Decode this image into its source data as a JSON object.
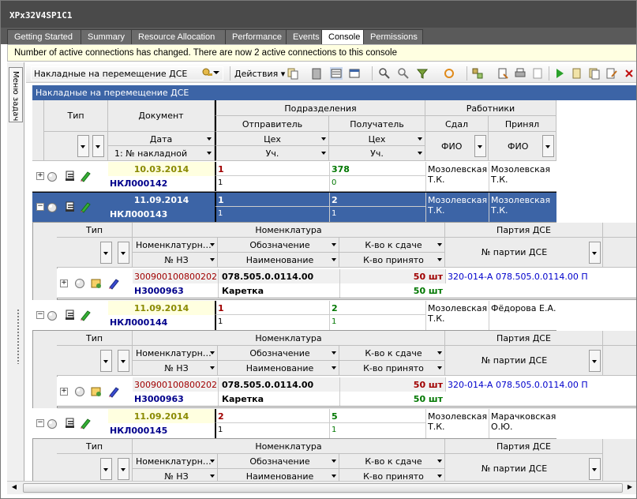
{
  "window": {
    "title": "XPx32V4SP1C1"
  },
  "tabs": [
    "Getting Started",
    "Summary",
    "Resource Allocation",
    "Performance",
    "Events",
    "Console",
    "Permissions"
  ],
  "notice": "Number of active connections has changed. There are now 2 active connections to this console",
  "leftpane": {
    "label": "Меню задач"
  },
  "toolbar": {
    "combo_value": "Накладные на перемещение ДСЕ",
    "actions_label": "Действия"
  },
  "grid": {
    "title": "Накладные на перемещение ДСЕ",
    "header": {
      "type": "Тип",
      "document": "Документ",
      "divisions": "Подразделения",
      "workers": "Работники",
      "sender": "Отправитель",
      "receiver": "Получатель",
      "gave": "Сдал",
      "took": "Принял",
      "date": "Дата",
      "doc_no": "1: № накладной",
      "shop1": "Цех",
      "shop2": "Цех",
      "sec1": "Уч.",
      "sec2": "Уч.",
      "fio1": "ФИО",
      "fio2": "ФИО"
    },
    "rows": [
      {
        "date": "10.03.2014",
        "doc": "НКЛ000142",
        "snd_shop": "1",
        "snd_sec": "1",
        "rcv_shop": "378",
        "rcv_sec": "0",
        "gave": "Мозолевская Т.К.",
        "took": "Мозолевская Т.К.",
        "expander": "+"
      },
      {
        "date": "11.09.2014",
        "doc": "НКЛ000143",
        "snd_shop": "1",
        "snd_sec": "1",
        "rcv_shop": "2",
        "rcv_sec": "1",
        "gave": "Мозолевская Т.К.",
        "took": "Мозолевская Т.К.",
        "expander": "−"
      },
      {
        "date": "11.09.2014",
        "doc": "НКЛ000144",
        "snd_shop": "1",
        "snd_sec": "1",
        "rcv_shop": "2",
        "rcv_sec": "1",
        "gave": "Мозолевская Т.К.",
        "took": "Фёдорова Е.А.",
        "expander": "−"
      },
      {
        "date": "11.09.2014",
        "doc": "НКЛ000145",
        "snd_shop": "2",
        "snd_sec": "1",
        "rcv_shop": "5",
        "rcv_sec": "1",
        "gave": "Мозолевская Т.К.",
        "took": "Марачковская О.Ю.",
        "expander": "−"
      }
    ],
    "detail_header": {
      "type": "Тип",
      "nomenclature": "Номенклатура",
      "batch": "Партия ДСЕ",
      "nom_no": "Номенклатурн…",
      "designation": "Обозначение",
      "qty_give": "К-во к сдаче",
      "nz": "№ НЗ",
      "name": "Наименование",
      "qty_taken": "К-во принято",
      "batch_no": "№ партии ДСЕ"
    },
    "details": [
      {
        "nom_no": "300900100800202",
        "designation": "078.505.0.0114.00",
        "qty_give": "50 шт",
        "nz": "Н3000963",
        "name": "Каретка",
        "qty_taken": "50 шт",
        "batch": "320-014-А 078.505.0.0114.00 П",
        "expander": "+"
      },
      {
        "nom_no": "300900100800202",
        "designation": "078.505.0.0114.00",
        "qty_give": "50 шт",
        "nz": "Н3000963",
        "name": "Каретка",
        "qty_taken": "50 шт",
        "batch": "320-014-А 078.505.0.0114.00 П",
        "expander": "+"
      }
    ]
  },
  "colors": {
    "selection": "#3c64a6",
    "date": "#8a8a00",
    "doc": "#00008b",
    "red": "#a00000",
    "green": "#007700",
    "batch": "#0000cc"
  }
}
